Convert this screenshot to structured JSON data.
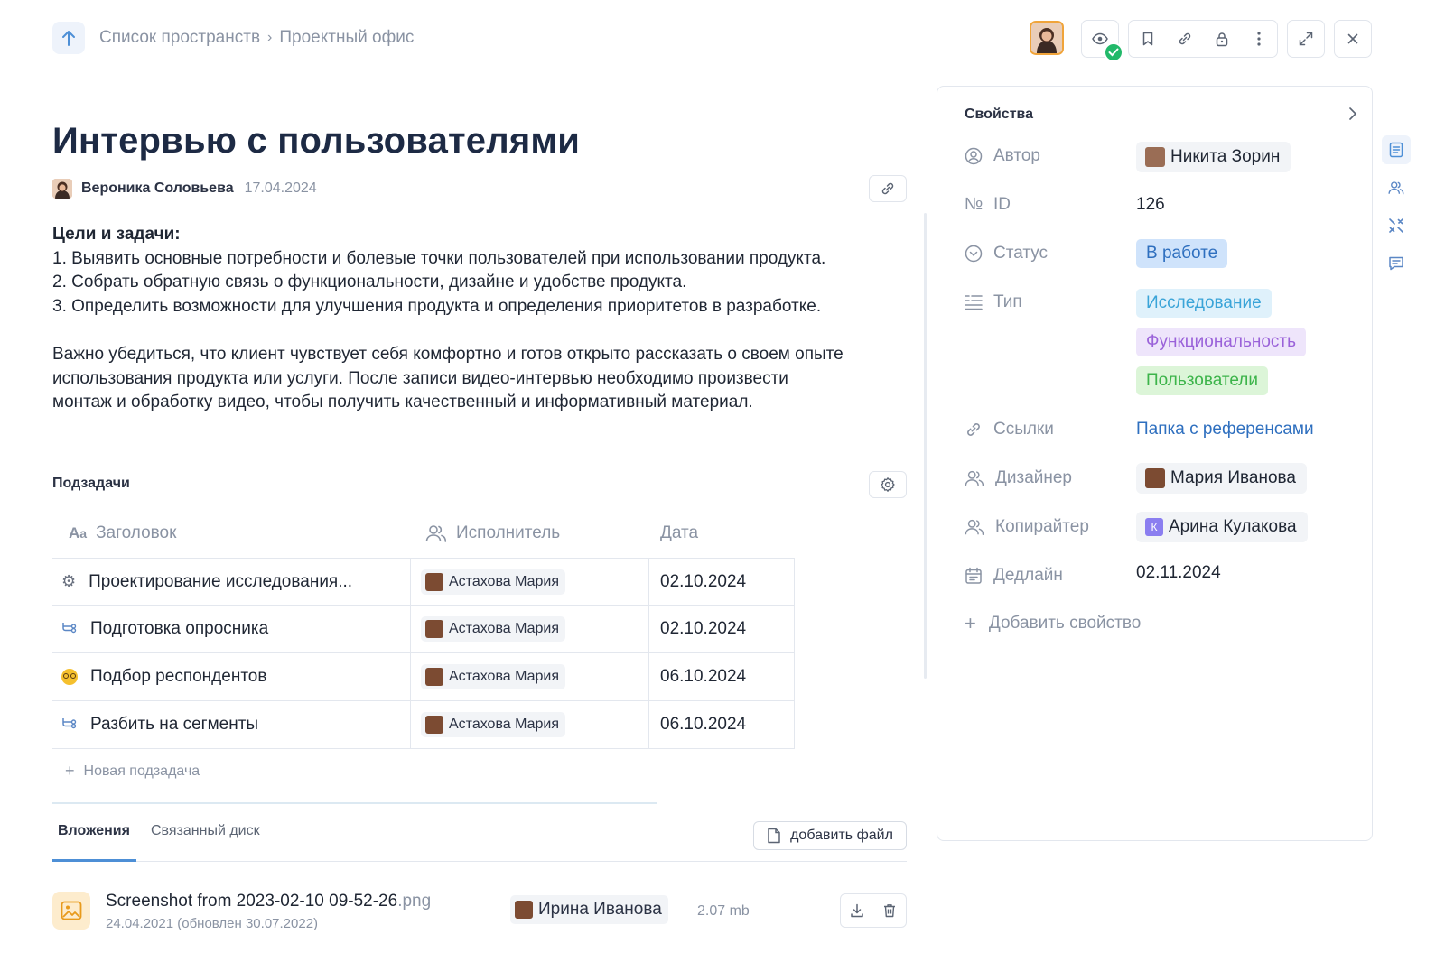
{
  "breadcrumb": {
    "root": "Список пространств",
    "separator": "›",
    "current": "Проектный офис"
  },
  "page": {
    "title": "Интервью с пользователями",
    "author": "Вероника Соловьева",
    "date": "17.04.2024"
  },
  "content": {
    "goals_heading": "Цели и задачи:",
    "goals": [
      "1. Выявить основные потребности и болевые точки пользователей при использовании продукта.",
      "2. Собрать обратную связь о функциональности, дизайне и удобстве продукта.",
      "3. Определить возможности для улучшения продукта и определения приоритетов в разработке."
    ],
    "paragraph_lines": [
      "Важно убедиться, что клиент чувствует себя комфортно и готов открыто рассказать о своем опыте",
      "использования продукта или услуги. После записи видео-интервью необходимо произвести",
      "монтаж и обработку видео, чтобы получить качественный и информативный материал."
    ]
  },
  "subtasks": {
    "title": "Подзадачи",
    "columns": {
      "title": "Заголовок",
      "executor": "Исполнитель",
      "date": "Дата"
    },
    "rows": [
      {
        "icon": "gear-emoji-icon",
        "title": "Проектирование исследования...",
        "executor": "Астахова Мария",
        "date": "02.10.2024"
      },
      {
        "icon": "subtask-icon",
        "title": "Подготовка опросника",
        "executor": "Астахова Мария",
        "date": "02.10.2024"
      },
      {
        "icon": "nerd-face-icon",
        "title": "Подбор респондентов",
        "executor": "Астахова Мария",
        "date": "06.10.2024"
      },
      {
        "icon": "subtask-icon",
        "title": "Разбить на сегменты",
        "executor": "Астахова Мария",
        "date": "06.10.2024"
      }
    ],
    "new_label": "Новая подзадача"
  },
  "attachments": {
    "tabs": [
      "Вложения",
      "Связанный диск"
    ],
    "active_tab": "Вложения",
    "add_file_label": "добавить файл",
    "files": [
      {
        "name": "Screenshot from 2023-02-10 09-52-26",
        "ext": ".png",
        "date": "24.04.2021 (обновлен 30.07.2022)",
        "owner": "Ирина Иванова",
        "size": "2.07 mb"
      }
    ]
  },
  "properties": {
    "title": "Свойства",
    "author_label": "Автор",
    "author": "Никита Зорин",
    "id_label": "ID",
    "id_prefix": "№",
    "id": "126",
    "status_label": "Статус",
    "status": "В работе",
    "type_label": "Тип",
    "types": [
      {
        "label": "Исследование",
        "bg": "#dff1fb",
        "color": "#3aa4d8"
      },
      {
        "label": "Функциональность",
        "bg": "#eee5fb",
        "color": "#9a62d9"
      },
      {
        "label": "Пользователи",
        "bg": "#dcf5d8",
        "color": "#3cb44a"
      }
    ],
    "links_label": "Ссылки",
    "link": "Папка с референсами",
    "designer_label": "Дизайнер",
    "designer": "Мария Иванова",
    "copywriter_label": "Копирайтер",
    "copywriter": "Арина Кулакова",
    "copywriter_initial": "К",
    "deadline_label": "Дедлайн",
    "deadline": "02.11.2024",
    "add_label": "Добавить свойство"
  },
  "colors": {
    "accent": "#4d8fd6",
    "status_bg": "#cfe3fb",
    "status_text": "#2e6fbf",
    "check": "#22b96a"
  }
}
